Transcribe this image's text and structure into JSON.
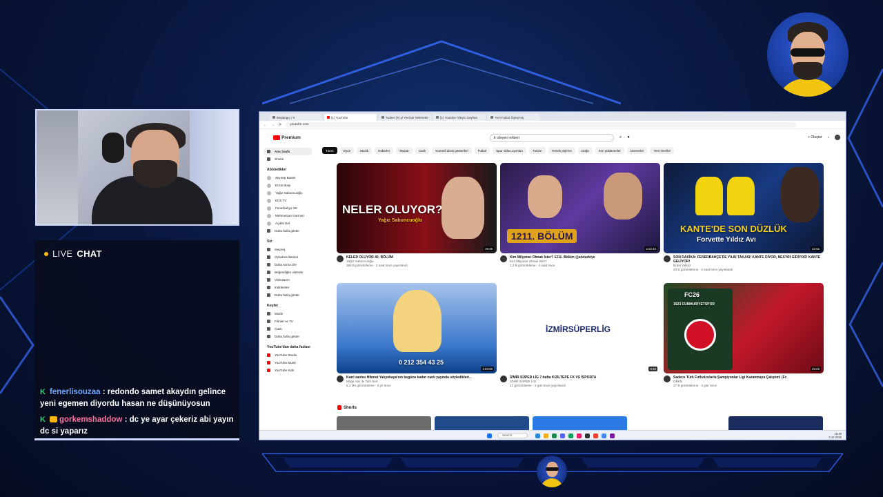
{
  "overlay": {
    "chat_header": {
      "live": "LIVE",
      "chat": "CHAT"
    },
    "chat_messages": [
      {
        "user": "fenerlisouzaa",
        "text": ": redondo samet akaydın gelince yeni egemen diyordu hasan ne düşünüyosun"
      },
      {
        "user": "gorkemshaddow",
        "text": ": dc ye ayar çekeriz abi yayın dc si yaparız"
      }
    ]
  },
  "browser": {
    "tabs": [
      {
        "label": "Başlangıç / X"
      },
      {
        "label": "(1) YouTube"
      },
      {
        "label": "Twitter (X) yi Yeni Bir Sekmede"
      },
      {
        "label": "(1) Youtube İzleyici Sayfası"
      },
      {
        "label": "Yeni Futbol Öyleymiş"
      }
    ],
    "url": "youtube.com",
    "search_query": "tr izleyen rehberi"
  },
  "youtube": {
    "logo": "Premium",
    "create_label": "+ Oluştur",
    "sidebar": {
      "main": [
        "Ana Sayfa",
        "Shorts"
      ],
      "subs_title": "Abonelikler",
      "subs": [
        "Zeynep Bastık",
        "Eczacıbaşı",
        "Yağız Sabuncuoğlu",
        "EDS TV",
        "Fenerbahçe SK",
        "Mehmetcan Gürmen",
        "Açıkla Gel"
      ],
      "subs_more": "Daha fazla göster",
      "you_title": "Siz",
      "you": [
        "Geçmiş",
        "Oynatma listeleri",
        "Daha sonra izle",
        "Beğendiğim videolar",
        "Videolarım",
        "İndirilenler",
        "Daha fazla göster"
      ],
      "explore_title": "Keşfet",
      "explore": [
        "Müzik",
        "Filmler ve TV",
        "Canlı",
        "Daha fazla göster"
      ],
      "more_title": "YouTube'dan daha fazlası",
      "more": [
        "YouTube Studio",
        "YouTube Music",
        "YouTube Kids"
      ]
    },
    "chips": [
      "Tümü",
      "Oyun",
      "Müzik",
      "Haberler",
      "Maçlar",
      "Canlı",
      "Komedi dizisi gösterileri",
      "Futbol",
      "Spor video oyunları",
      "Turizm",
      "Yemek pişirme",
      "Doğa",
      "Son yüklenenler",
      "İzlenenler",
      "Yeni öneriler"
    ],
    "videos": [
      {
        "thumb_text": "NELER OLUYOR?",
        "thumb_sub": "Yağız Sabuncuoğlu",
        "duration": "49:28",
        "title": "NELER OLUYOR 40. BÖLÜM",
        "channel": "Yağız Sabuncuoğlu",
        "stats": "299 B görüntüleme · 2 saat önce yayınlandı"
      },
      {
        "thumb_text": "1211. BÖLÜM",
        "duration": "2:22:42",
        "title": "Kim Milyoner Olmak İster? 1211. Bölüm @atvturkiye",
        "channel": "Kim Milyoner Olmak İster?",
        "stats": "1,2 B görüntüleme · 4 saat önce"
      },
      {
        "thumb_text": "KANTE'DE SON DÜZLÜK",
        "thumb_sub": "Forvette Yıldız Avı",
        "duration": "42:02",
        "title": "SON DAKİKA: FENERBAHÇE'DE YILIN TAKASI! KANTE DİYOR, NESYRİ GİDİYOR! KANTE GELİYOR!",
        "channel": "Erdal Yalkaz",
        "stats": "20 B görüntüleme · 2 saat önce yayınlandı"
      },
      {
        "thumb_text": "0 212 354 43 25",
        "duration": "1:03:59",
        "title": "Kazıl zanlısı Hikmet Yalçınkaya'nın bugüne kadar canlı yayında söyledikleri...",
        "channel": "Müge Anlı ile Tatlı Sert",
        "stats": "5,2 Mn görüntüleme · 6 yıl önce"
      },
      {
        "thumb_text": "İZMİRSÜPERLİG",
        "duration": "0:46",
        "title": "İZMİR SÜPER LİG 7.hafta KIZILTEPE FK VS İSPORTA",
        "channel": "İZMİR SÜPER LİG",
        "stats": "21 görüntüleme · 2 gün önce yayınlandı"
      },
      {
        "thumb_text": "FC26",
        "thumb_sub": "1923 CUMHURIYETSPOR",
        "duration": "25:03",
        "title": "Sadece Türk Futbolcularla Şampiyonlar Ligi Kazanmaya Çalıştım! (Fc",
        "channel": "OBKN",
        "stats": "27 B görüntüleme · 3 gün önce"
      }
    ],
    "shorts_title": "Shorts",
    "taskbar_search": "Search",
    "clock_time": "18:49",
    "clock_date": "2.10.2025"
  },
  "colors": {
    "accent": "#f5c21b",
    "yt_red": "#ff0000",
    "user1": "#6fa5ff",
    "user2": "#ff6fa0"
  }
}
